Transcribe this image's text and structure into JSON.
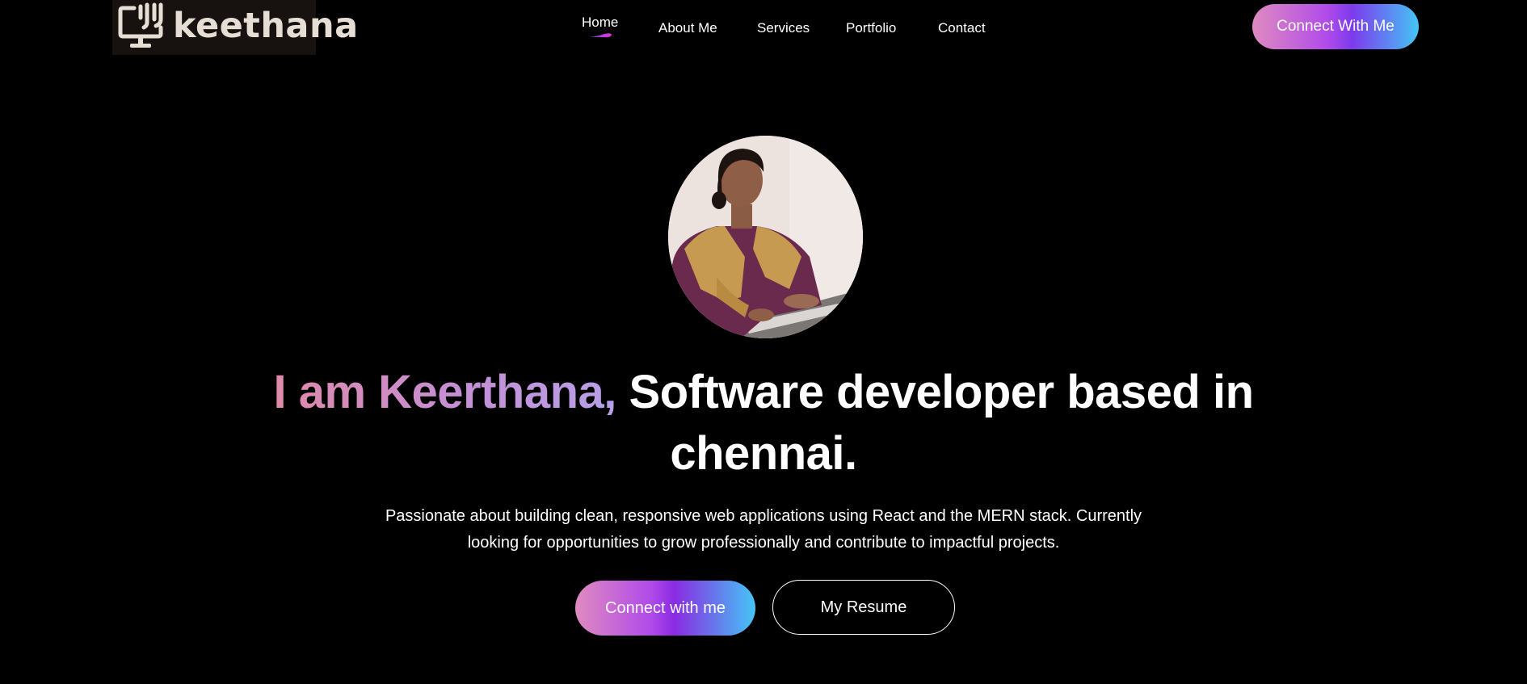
{
  "brand": {
    "logo_text": "keethana",
    "logo_icon": "computer-monitor-icon",
    "logo_bg": "#17120f",
    "logo_fg": "#e6ddd4"
  },
  "nav": {
    "items": [
      {
        "label": "Home",
        "active": true
      },
      {
        "label": "About Me",
        "active": false
      },
      {
        "label": "Services",
        "active": false
      },
      {
        "label": "Portfolio",
        "active": false
      },
      {
        "label": "Contact",
        "active": false
      }
    ],
    "cta_label": "Connect With Me"
  },
  "hero": {
    "headline_highlight": "I am Keerthana,",
    "headline_rest": "Software developer based in chennai.",
    "description": "Passionate about building clean, responsive web applications using React and the MERN stack. Currently looking for opportunities to grow professionally and contribute to impactful projects.",
    "primary_button": "Connect with me",
    "secondary_button": "My Resume"
  },
  "colors": {
    "background": "#000000",
    "gradient_start": "#df8ac0",
    "gradient_mid": "#8a2be2",
    "gradient_end": "#45c5f5",
    "text": "#ffffff"
  }
}
